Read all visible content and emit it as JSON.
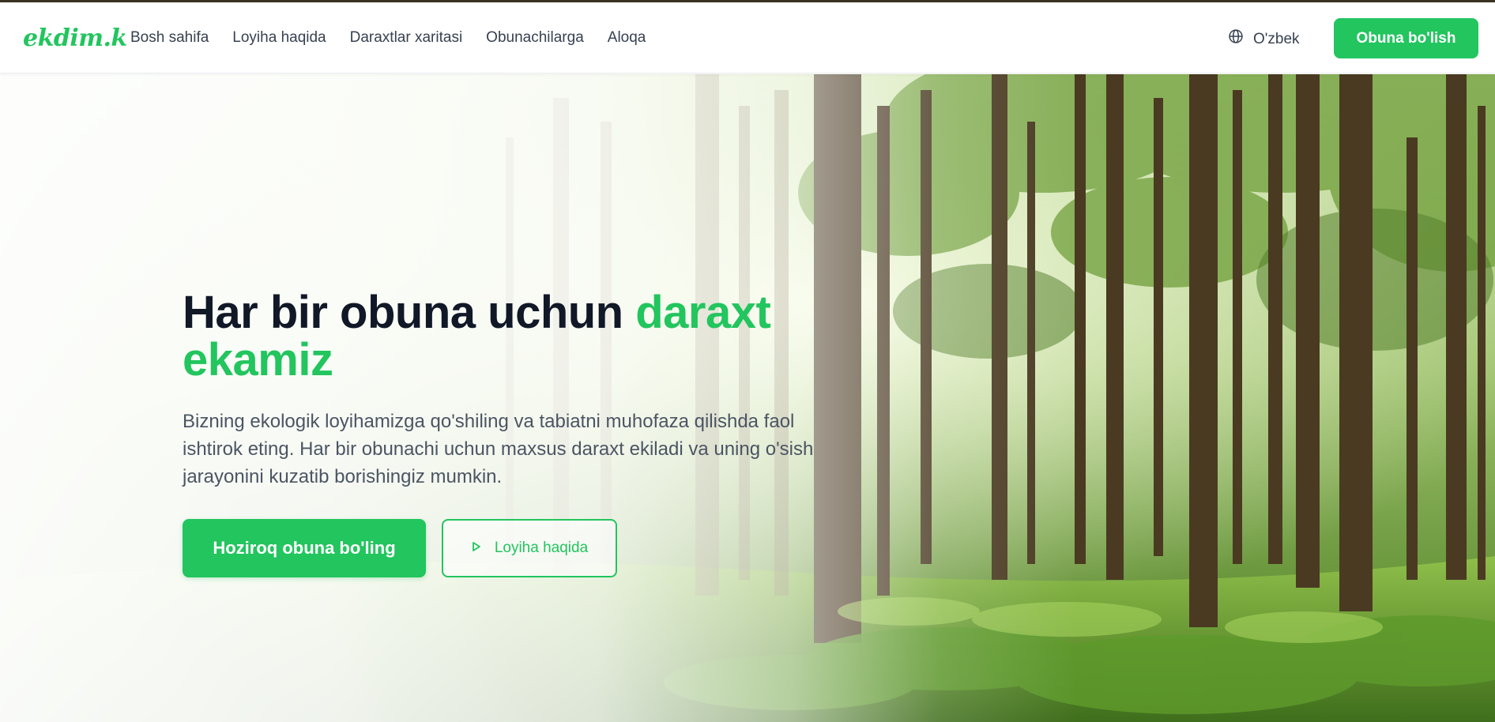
{
  "header": {
    "logo": "ekdim.k",
    "nav": [
      "Bosh sahifa",
      "Loyiha haqida",
      "Daraxtlar xaritasi",
      "Obunachilarga",
      "Aloqa"
    ],
    "language": "O'zbek",
    "cta": "Obuna bo'lish"
  },
  "hero": {
    "title_main": "Har bir obuna uchun ",
    "title_accent": "daraxt ekamiz",
    "description": "Bizning ekologik loyihamizga qo'shiling va tabiatni muhofaza qilishda faol ishtirok eting. Har bir obunachi uchun maxsus daraxt ekiladi va uning o'sish jarayonini kuzatib borishingiz mumkin.",
    "primary_button": "Hoziroq obuna bo'ling",
    "secondary_button": "Loyiha haqida"
  },
  "colors": {
    "accent": "#22c55e",
    "heading": "#111827",
    "text": "#4b5563"
  },
  "icons": {
    "language": "globe-icon",
    "secondary_button": "play-icon"
  }
}
